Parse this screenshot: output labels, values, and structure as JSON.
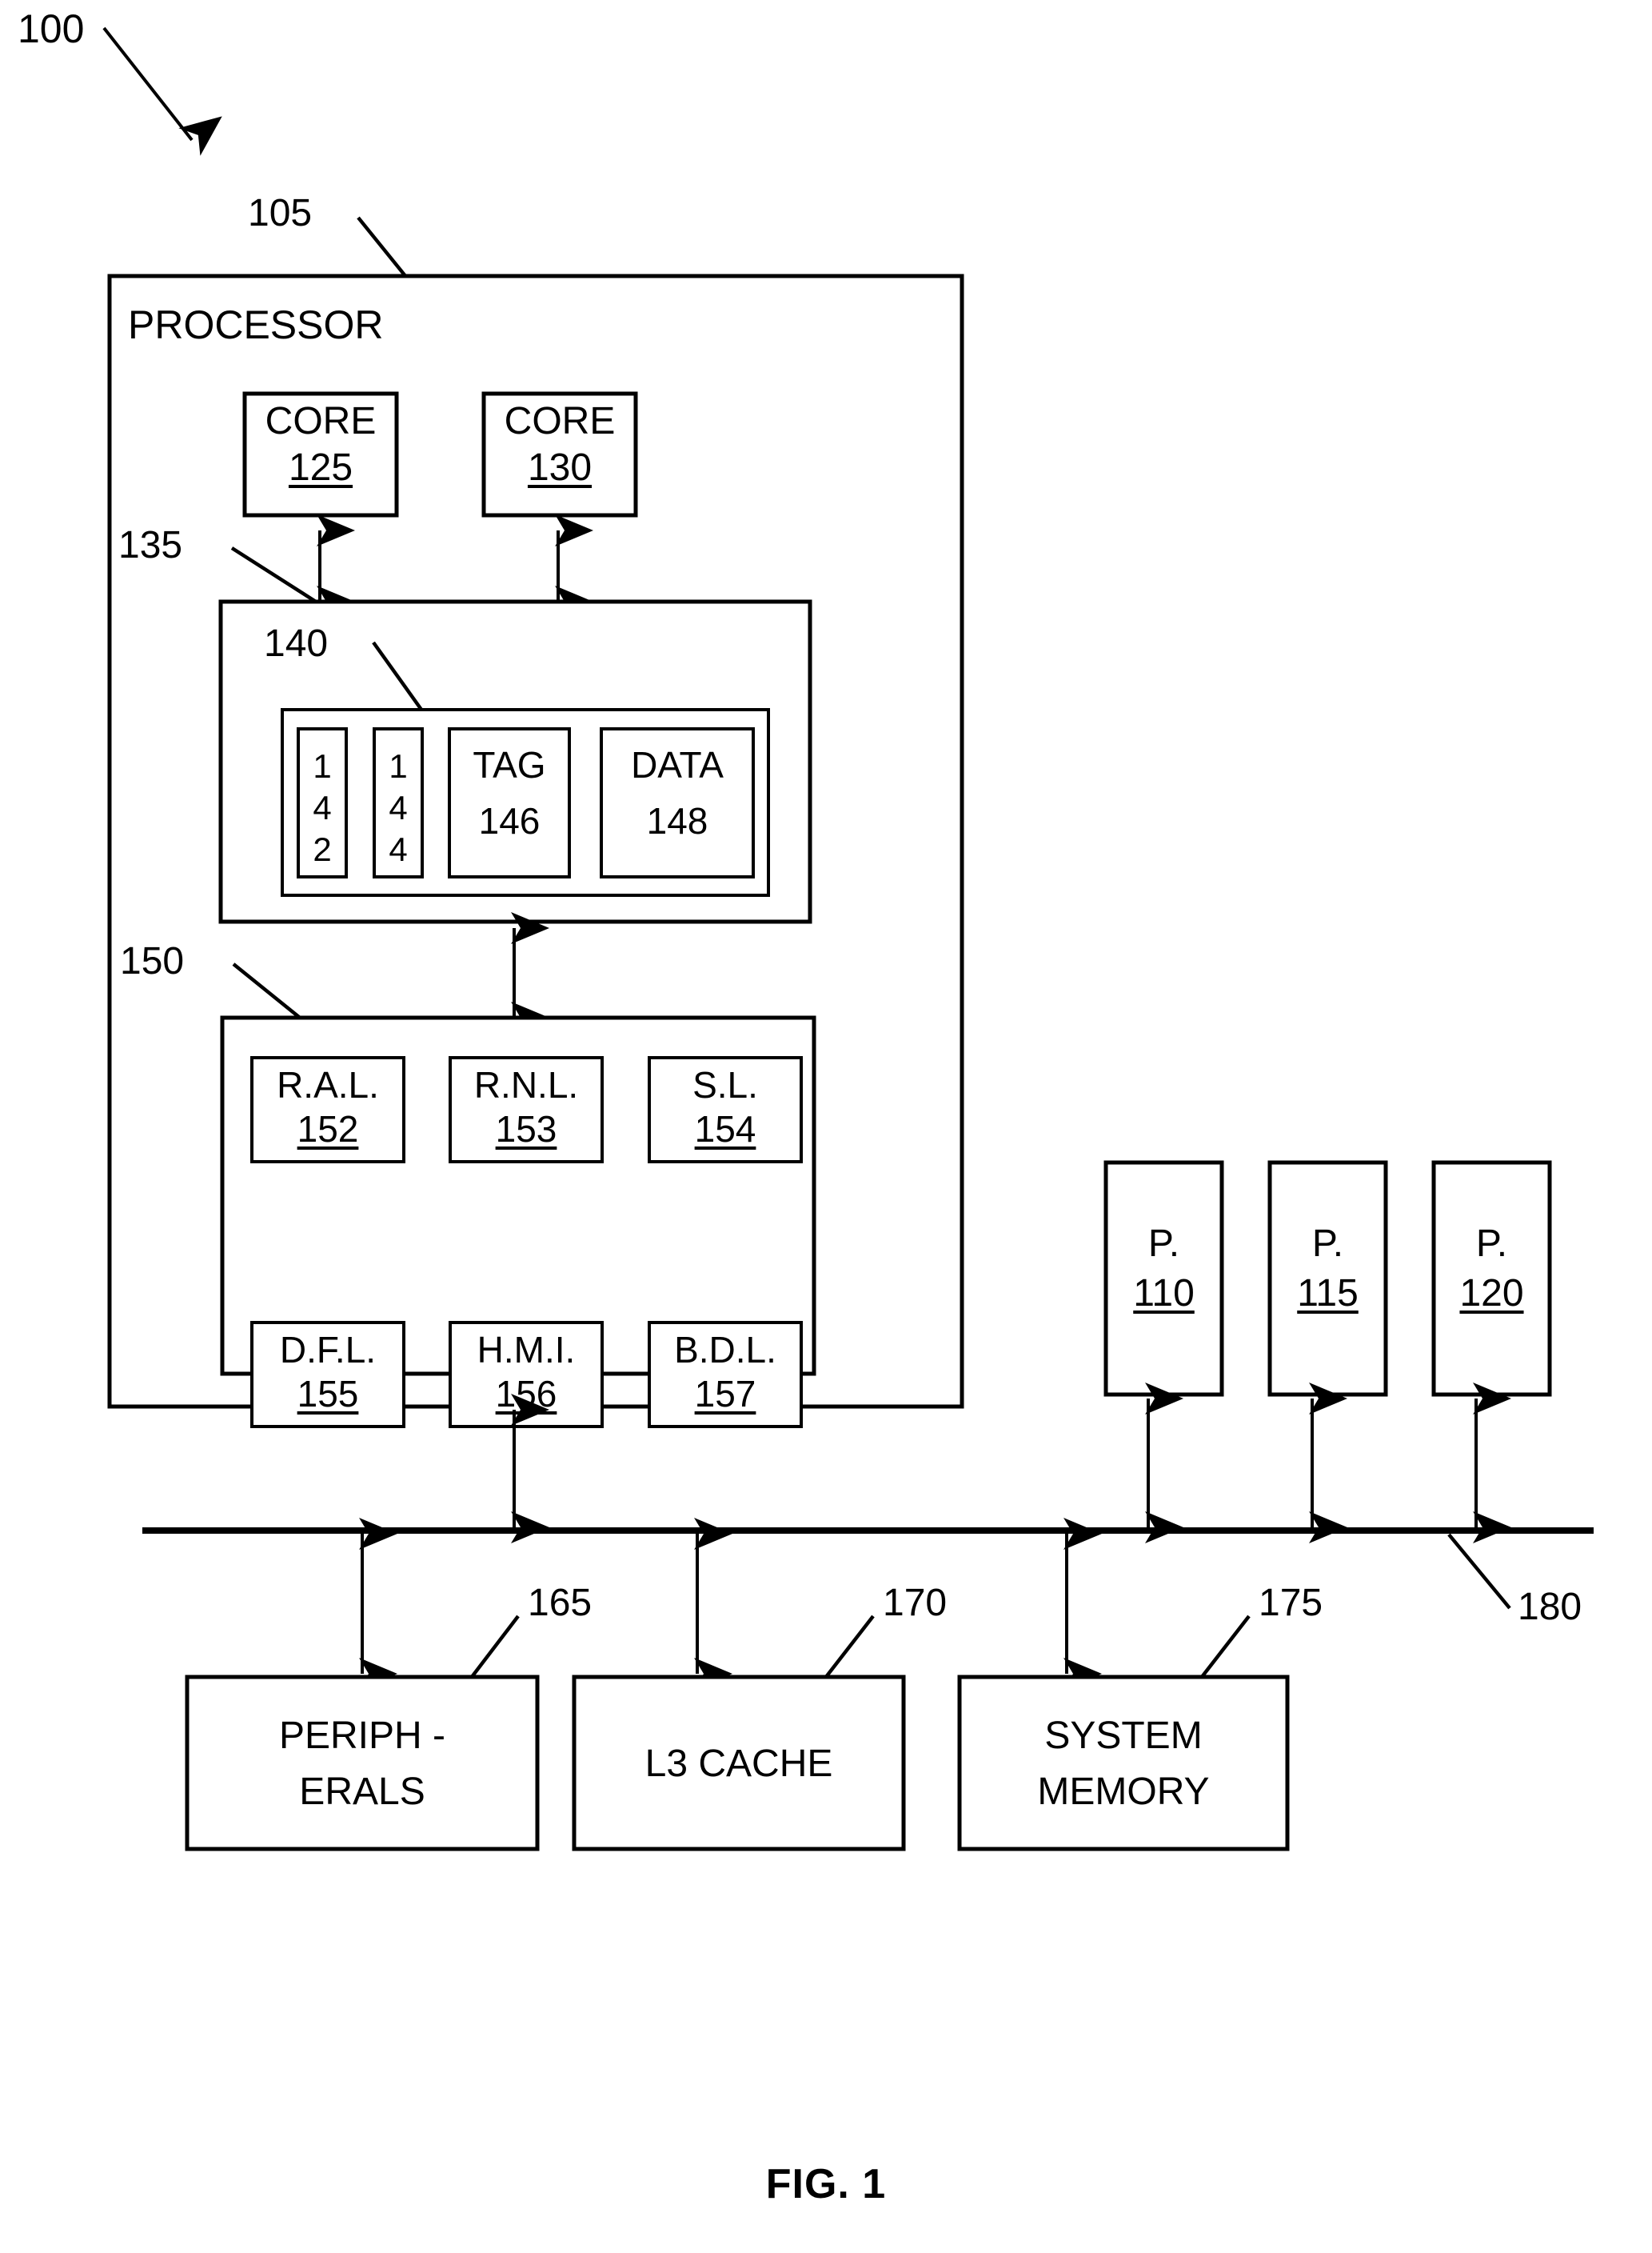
{
  "figure": {
    "caption": "FIG. 1",
    "system_ref": "100"
  },
  "processor": {
    "title": "PROCESSOR",
    "ref": "105",
    "cores": [
      {
        "label": "CORE",
        "ref": "125"
      },
      {
        "label": "CORE",
        "ref": "130"
      }
    ],
    "cache_group": {
      "ref": "135",
      "inner_ref": "140",
      "cells": [
        {
          "label": "",
          "ref": "142",
          "stacked": [
            "1",
            "4",
            "2"
          ]
        },
        {
          "label": "",
          "ref": "144",
          "stacked": [
            "1",
            "4",
            "4"
          ]
        },
        {
          "label": "TAG",
          "ref": "146",
          "stacked": []
        },
        {
          "label": "DATA",
          "ref": "148",
          "stacked": []
        }
      ]
    },
    "logic_group": {
      "ref": "150",
      "units": [
        {
          "label": "R.A.L.",
          "ref": "152"
        },
        {
          "label": "R.N.L.",
          "ref": "153"
        },
        {
          "label": "S.L.",
          "ref": "154"
        },
        {
          "label": "D.F.L.",
          "ref": "155"
        },
        {
          "label": "H.M.I.",
          "ref": "156"
        },
        {
          "label": "B.D.L.",
          "ref": "157"
        }
      ]
    }
  },
  "bus": {
    "ref": "180"
  },
  "processors_right": [
    {
      "label": "P.",
      "ref": "110"
    },
    {
      "label": "P.",
      "ref": "115"
    },
    {
      "label": "P.",
      "ref": "120"
    }
  ],
  "bottom_blocks": [
    {
      "line1": "PERIPH -",
      "line2": "ERALS",
      "ref": "165"
    },
    {
      "line1": "L3 CACHE",
      "line2": "",
      "ref": "170"
    },
    {
      "line1": "SYSTEM",
      "line2": "MEMORY",
      "ref": "175"
    }
  ],
  "colors": {
    "ink": "#000000",
    "paper": "#ffffff"
  }
}
